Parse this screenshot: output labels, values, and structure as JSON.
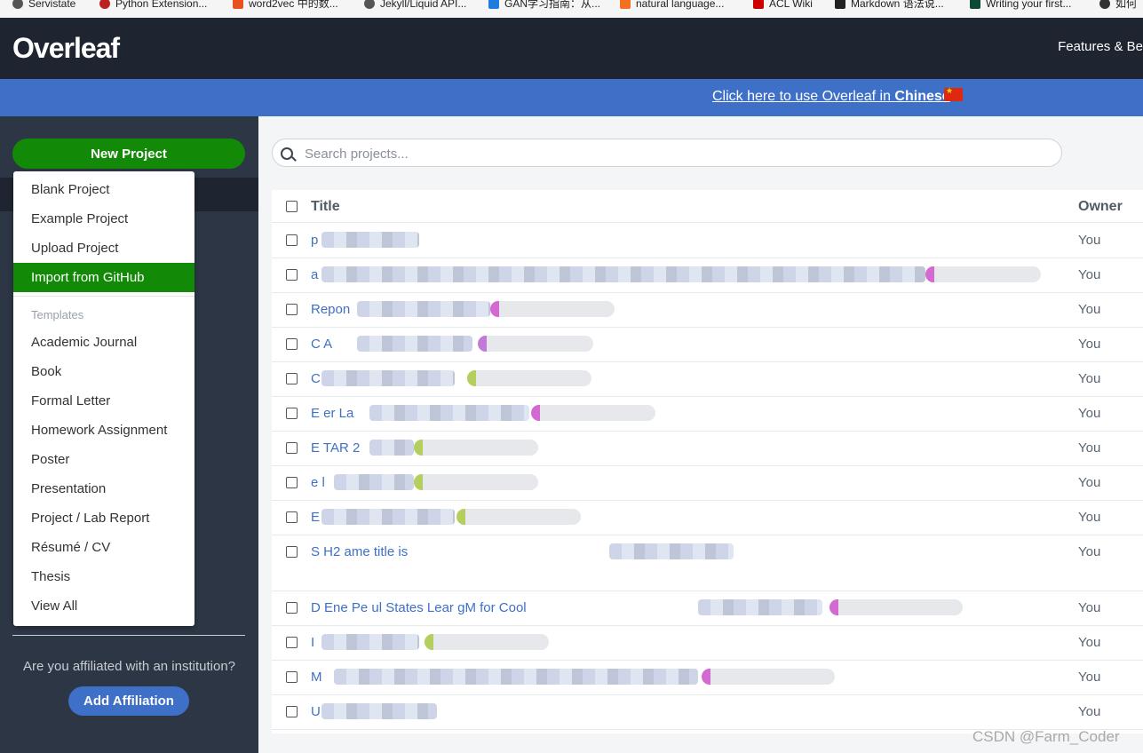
{
  "bookmarks": [
    {
      "label": "Servistate",
      "color": "#555"
    },
    {
      "label": "Python Extension...",
      "color": "#b22"
    },
    {
      "label": "word2vec 中的数...",
      "color": "#e8501e"
    },
    {
      "label": "Jekyll/Liquid API...",
      "color": "#555"
    },
    {
      "label": "GAN学习指南：从...",
      "color": "#1e7be0"
    },
    {
      "label": "natural language...",
      "color": "#f37021"
    },
    {
      "label": "ACL Wiki",
      "color": "#c00"
    },
    {
      "label": "Markdown 语法说...",
      "color": "#222"
    },
    {
      "label": "Writing your first...",
      "color": "#0c4b33"
    },
    {
      "label": "如何",
      "color": "#333"
    }
  ],
  "navbar": {
    "logo": "Overleaf",
    "link": "Features & Be"
  },
  "banner": {
    "text_prefix": "Click here to use Overleaf in ",
    "text_bold": "Chinese"
  },
  "sidebar": {
    "new_project": "New Project",
    "affiliation_question": "Are you affiliated with an institution?",
    "add_affiliation": "Add Affiliation"
  },
  "dropdown": {
    "items": [
      "Blank Project",
      "Example Project",
      "Upload Project",
      "Import from GitHub"
    ],
    "templates_header": "Templates",
    "templates": [
      "Academic Journal",
      "Book",
      "Formal Letter",
      "Homework Assignment",
      "Poster",
      "Presentation",
      "Project / Lab Report",
      "Résumé / CV",
      "Thesis",
      "View All"
    ]
  },
  "search": {
    "placeholder": "Search projects..."
  },
  "table": {
    "headers": {
      "title": "Title",
      "owner": "Owner"
    },
    "rows": [
      {
        "title": "p",
        "owner": "You"
      },
      {
        "title": "a",
        "owner": "You"
      },
      {
        "title": "Repon",
        "owner": "You"
      },
      {
        "title": "C A",
        "owner": "You"
      },
      {
        "title": "C",
        "owner": "You"
      },
      {
        "title": "E er La",
        "owner": "You"
      },
      {
        "title": "E TAR 2",
        "owner": "You"
      },
      {
        "title": "e l",
        "owner": "You"
      },
      {
        "title": "E",
        "owner": "You"
      },
      {
        "title": "S H2 ame title is",
        "owner": "You"
      },
      {
        "title": "D Ene Pe ul States Lear gM for Cool",
        "owner": "You"
      },
      {
        "title": "I",
        "owner": "You"
      },
      {
        "title": "M",
        "owner": "You"
      },
      {
        "title": "U",
        "owner": "You"
      }
    ]
  },
  "watermark": "CSDN @Farm_Coder"
}
